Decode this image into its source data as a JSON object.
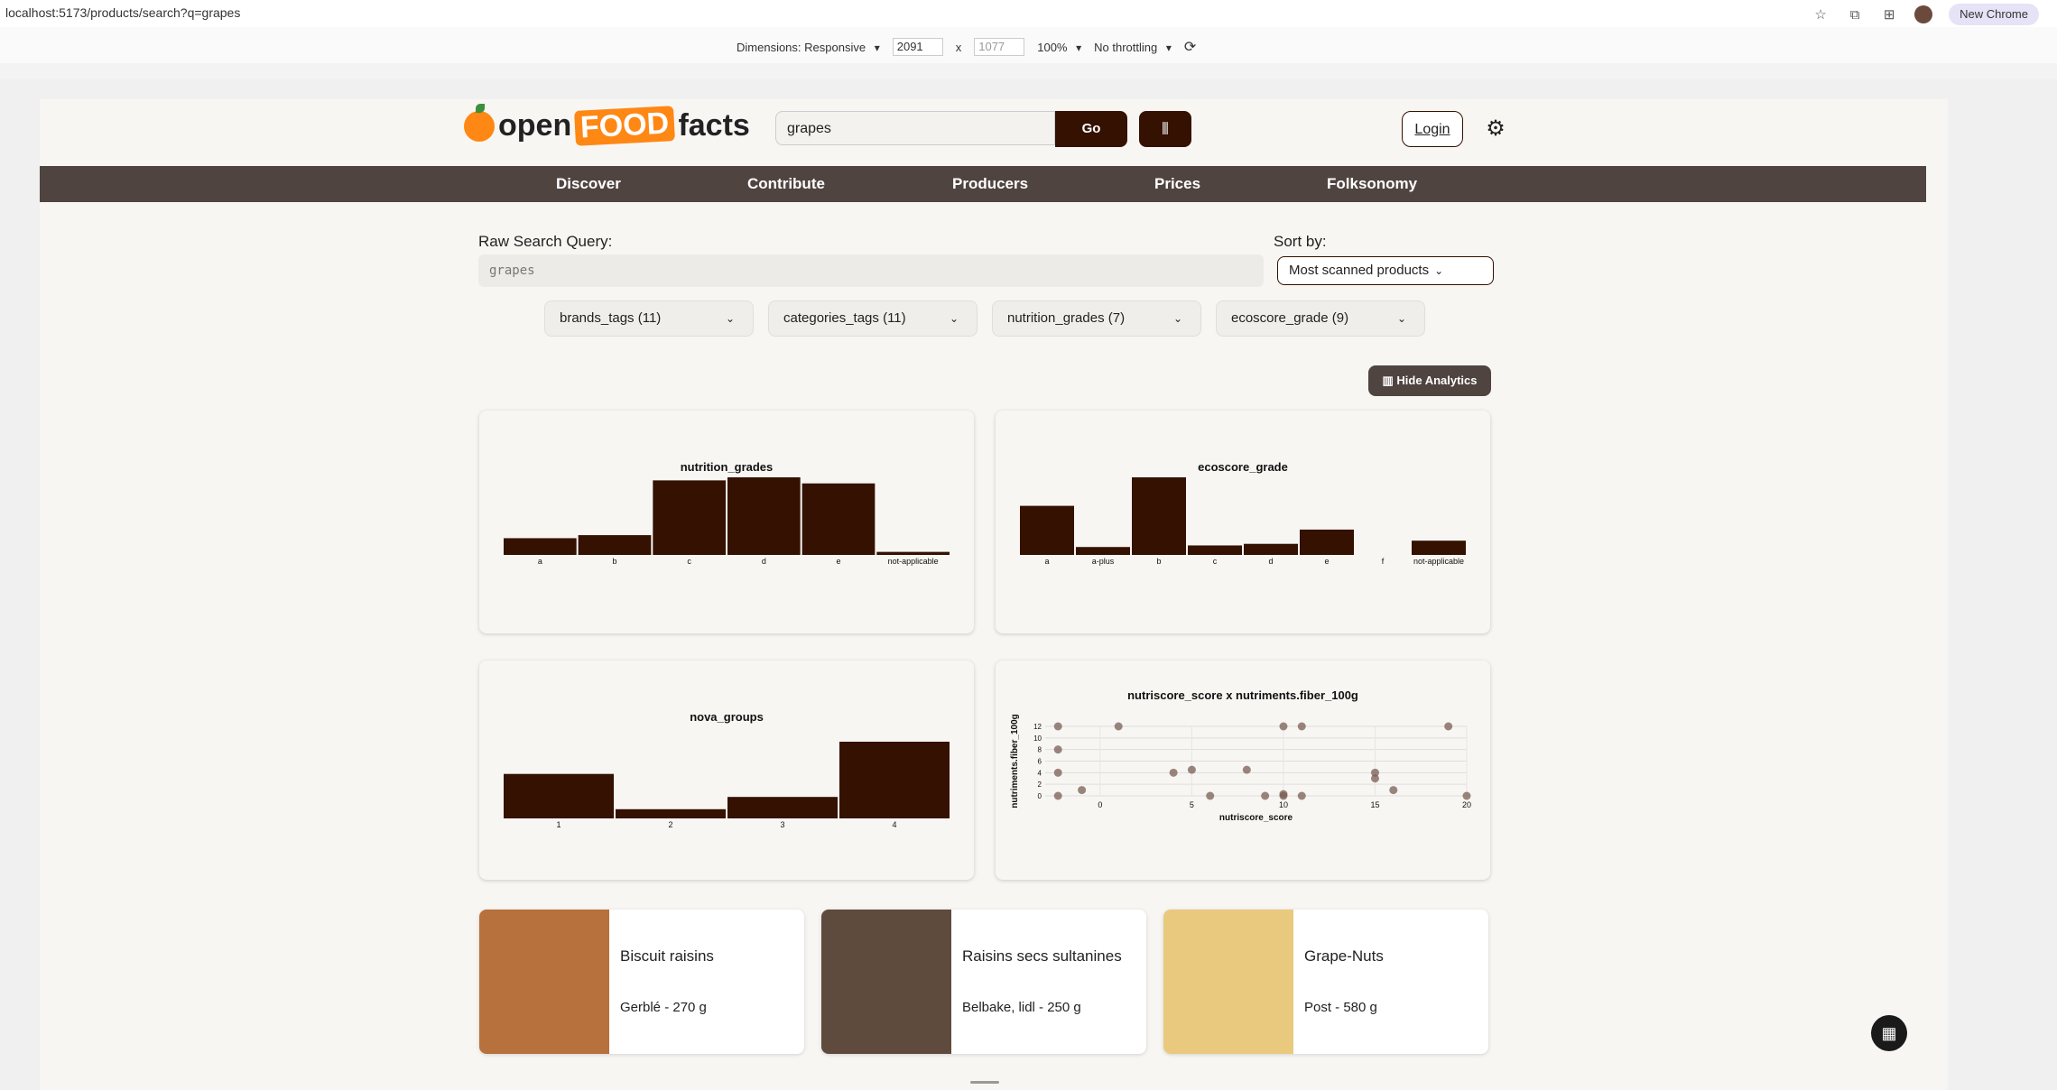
{
  "browser": {
    "url": "localhost:5173/products/search?q=grapes",
    "new_chrome_label": "New Chrome",
    "icons": [
      "star-icon",
      "extension-icon",
      "profile-icon"
    ]
  },
  "devtools": {
    "dimensions_label": "Dimensions: Responsive",
    "width": "2091",
    "times": "x",
    "height": "1077",
    "zoom": "100%",
    "throttling": "No throttling"
  },
  "header": {
    "logo": {
      "open": "open",
      "food": "FOOD",
      "facts": "facts"
    },
    "search_value": "grapes",
    "go_label": "Go",
    "login_label": "Login"
  },
  "nav": {
    "items": [
      {
        "label": "Discover"
      },
      {
        "label": "Contribute"
      },
      {
        "label": "Producers"
      },
      {
        "label": "Prices"
      },
      {
        "label": "Folksonomy"
      }
    ]
  },
  "search_panel": {
    "raw_label": "Raw Search Query:",
    "raw_value": "grapes",
    "sort_label": "Sort by:",
    "sort_value": "Most scanned products"
  },
  "filters": [
    {
      "label": "brands_tags (11)"
    },
    {
      "label": "categories_tags (11)"
    },
    {
      "label": "nutrition_grades (7)"
    },
    {
      "label": "ecoscore_grade (9)"
    }
  ],
  "hide_analytics_label": "Hide Analytics",
  "chart_data": [
    {
      "type": "bar",
      "title": "nutrition_grades",
      "categories": [
        "a",
        "b",
        "c",
        "d",
        "e",
        "not-applicable"
      ],
      "values": [
        2.2,
        2.6,
        9.8,
        10.2,
        9.4,
        0.4
      ]
    },
    {
      "type": "bar",
      "title": "ecoscore_grade",
      "categories": [
        "a",
        "a-plus",
        "b",
        "c",
        "d",
        "e",
        "f",
        "not-applicable"
      ],
      "values": [
        6.2,
        1.0,
        9.8,
        1.2,
        1.4,
        3.2,
        0,
        1.8
      ]
    },
    {
      "type": "bar",
      "title": "nova_groups",
      "categories": [
        "1",
        "2",
        "3",
        "4"
      ],
      "values": [
        5.8,
        1.2,
        2.8,
        10.0
      ]
    },
    {
      "type": "scatter",
      "title": "nutriscore_score x nutriments.fiber_100g",
      "xlabel": "nutriscore_score",
      "ylabel": "nutriments.fiber_100g",
      "xlim": [
        -3,
        20
      ],
      "ylim": [
        0,
        12
      ],
      "x_ticks": [
        0,
        5,
        10,
        15,
        20
      ],
      "y_ticks": [
        0,
        2,
        4,
        6,
        8,
        10,
        12
      ],
      "points": [
        {
          "x": -2.3,
          "y": 12
        },
        {
          "x": 1,
          "y": 12
        },
        {
          "x": 10,
          "y": 12
        },
        {
          "x": 11,
          "y": 12
        },
        {
          "x": 19,
          "y": 12
        },
        {
          "x": -2.3,
          "y": 8
        },
        {
          "x": -2.3,
          "y": 4
        },
        {
          "x": 4,
          "y": 4
        },
        {
          "x": 5,
          "y": 4.5
        },
        {
          "x": 8,
          "y": 4.5
        },
        {
          "x": 15,
          "y": 4
        },
        {
          "x": 15,
          "y": 3
        },
        {
          "x": -1,
          "y": 1
        },
        {
          "x": 16,
          "y": 1
        },
        {
          "x": 6,
          "y": 0
        },
        {
          "x": 9,
          "y": 0
        },
        {
          "x": 10,
          "y": 0
        },
        {
          "x": 10,
          "y": 0.3
        },
        {
          "x": 11,
          "y": 0
        },
        {
          "x": 20,
          "y": 0
        },
        {
          "x": -2.3,
          "y": 0
        }
      ]
    }
  ],
  "products": [
    {
      "name": "Biscuit raisins",
      "subtitle": "Gerblé - 270 g",
      "img_color": "#b7713c"
    },
    {
      "name": "Raisins secs sultanines",
      "subtitle": "Belbake, lidl - 250 g",
      "img_color": "#5e4b3e"
    },
    {
      "name": "Grape-Nuts",
      "subtitle": "Post - 580 g",
      "img_color": "#e8c97e"
    }
  ],
  "colors": {
    "bar": "#341100",
    "nav": "#504441",
    "accent": "#ff8714",
    "scatter_point": "#7a5e54"
  }
}
